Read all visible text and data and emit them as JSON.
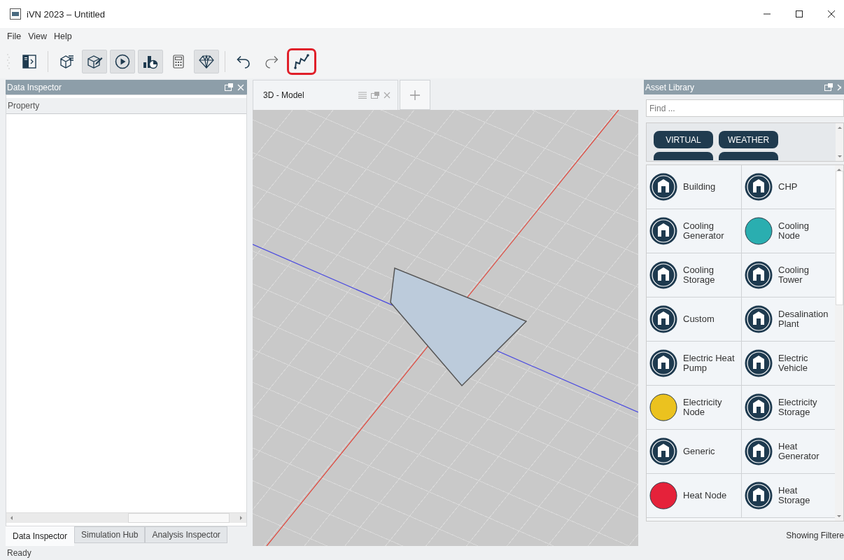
{
  "window": {
    "title": "iVN 2023 – Untitled"
  },
  "menu": [
    "File",
    "View",
    "Help"
  ],
  "toolbar": [
    {
      "pressed": false,
      "highlighted": false
    },
    {
      "pressed": false,
      "highlighted": false
    },
    {
      "pressed": true,
      "highlighted": false
    },
    {
      "pressed": true,
      "highlighted": false
    },
    {
      "pressed": true,
      "highlighted": false
    },
    {
      "pressed": false,
      "highlighted": false
    },
    {
      "pressed": true,
      "highlighted": false
    },
    {
      "pressed": false,
      "highlighted": false
    },
    {
      "pressed": false,
      "highlighted": false
    },
    {
      "pressed": false,
      "highlighted": true
    }
  ],
  "data_inspector": {
    "title": "Data Inspector",
    "column": "Property"
  },
  "left_tabs": [
    {
      "label": "Data Inspector",
      "selected": true
    },
    {
      "label": "Simulation Hub",
      "selected": false
    },
    {
      "label": "Analysis Inspector",
      "selected": false
    }
  ],
  "document_tabs": [
    {
      "label": "3D - Model",
      "selected": true
    }
  ],
  "asset_library": {
    "title": "Asset Library",
    "search": {
      "placeholder": "Find ..."
    },
    "tags": [
      {
        "label": "VIRTUAL"
      },
      {
        "label": "WEATHER"
      }
    ],
    "items": [
      {
        "label": "Building",
        "kind": "asset"
      },
      {
        "label": "CHP",
        "kind": "asset"
      },
      {
        "label": "Cooling Generator",
        "kind": "asset"
      },
      {
        "label": "Cooling Node",
        "kind": "node",
        "color": "#2aaeb0"
      },
      {
        "label": "Cooling Storage",
        "kind": "asset"
      },
      {
        "label": "Cooling Tower",
        "kind": "asset"
      },
      {
        "label": "Custom",
        "kind": "asset"
      },
      {
        "label": "Desalination Plant",
        "kind": "asset"
      },
      {
        "label": "Electric Heat Pump",
        "kind": "asset"
      },
      {
        "label": "Electric Vehicle",
        "kind": "asset"
      },
      {
        "label": "Electricity Node",
        "kind": "node",
        "color": "#ebc21f"
      },
      {
        "label": "Electricity Storage",
        "kind": "asset"
      },
      {
        "label": "Generic",
        "kind": "asset"
      },
      {
        "label": "Heat Generator",
        "kind": "asset"
      },
      {
        "label": "Heat Node",
        "kind": "node",
        "color": "#e5223a"
      },
      {
        "label": "Heat Storage",
        "kind": "asset"
      }
    ],
    "footer": "Showing Filtere"
  },
  "status_bar": "Ready"
}
